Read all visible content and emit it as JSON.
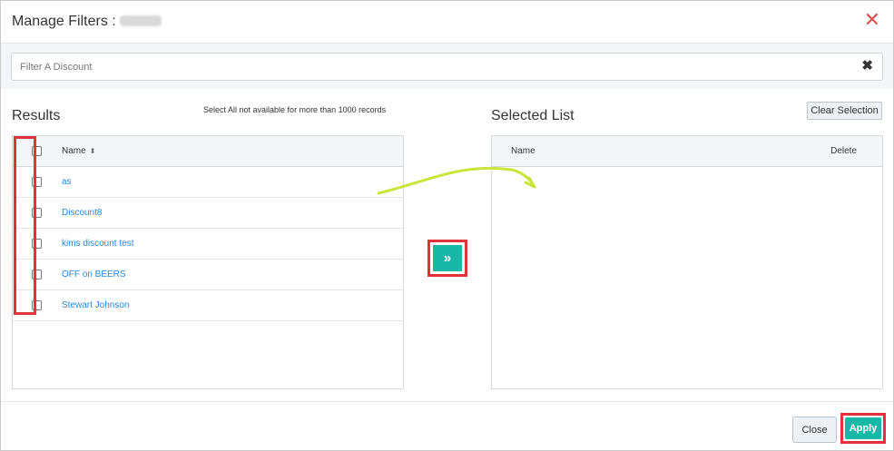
{
  "header": {
    "title": "Manage Filters :",
    "close_icon": "close-icon",
    "close_glyph": "✕"
  },
  "filter": {
    "placeholder": "Filter A Discount",
    "value": "",
    "clear_glyph": "✖"
  },
  "results": {
    "title": "Results",
    "note": "Select All not available for more than 1000 records",
    "columns": {
      "name": "Name"
    },
    "sort_glyph": "⬍",
    "items": [
      {
        "label": "as"
      },
      {
        "label": "Discount8"
      },
      {
        "label": "kims discount test"
      },
      {
        "label": "OFF on BEERS"
      },
      {
        "label": "Stewart Johnson"
      }
    ]
  },
  "move": {
    "glyph": "»"
  },
  "selected": {
    "title": "Selected List",
    "clear_label": "Clear Selection",
    "columns": {
      "name": "Name",
      "delete": "Delete"
    },
    "items": []
  },
  "footer": {
    "close_label": "Close",
    "apply_label": "Apply"
  },
  "colors": {
    "accent": "#19b8a6",
    "link": "#1e88e5",
    "highlight": "#e0333a",
    "arrow": "#c8e63a"
  }
}
